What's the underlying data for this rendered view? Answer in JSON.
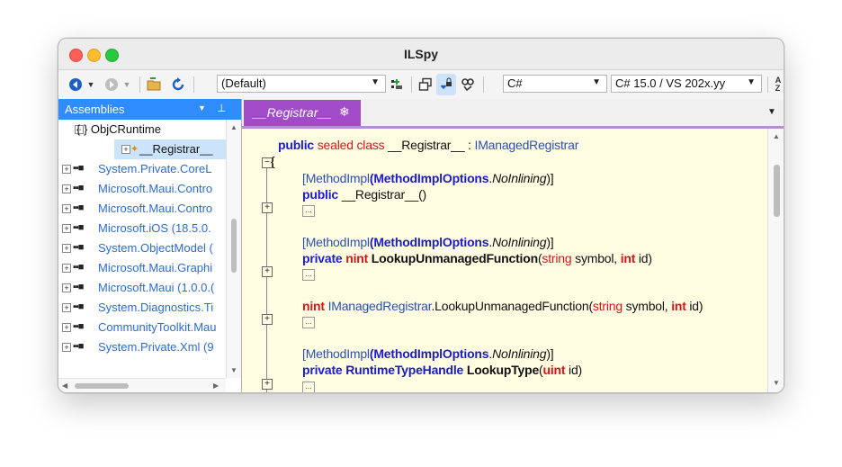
{
  "window": {
    "title": "ILSpy"
  },
  "toolbar": {
    "profile_combo": "(Default)",
    "language_combo": "C#",
    "version_combo": "C# 15.0 / VS 202x.yy"
  },
  "assemblies_panel": {
    "header": "Assemblies",
    "tree": [
      {
        "label": "{ } ObjCRuntime",
        "style": "dark",
        "indent": 1
      },
      {
        "label": "__Registrar__",
        "style": "dark",
        "indent": 2,
        "selected": true
      },
      {
        "label": "System.Private.CoreL",
        "indent": 0
      },
      {
        "label": "Microsoft.Maui.Contro",
        "indent": 0
      },
      {
        "label": "Microsoft.Maui.Contro",
        "indent": 0
      },
      {
        "label": "Microsoft.iOS (18.5.0.",
        "indent": 0
      },
      {
        "label": "System.ObjectModel (",
        "indent": 0
      },
      {
        "label": "Microsoft.Maui.Graphi",
        "indent": 0
      },
      {
        "label": "Microsoft.Maui (1.0.0.(",
        "indent": 0
      },
      {
        "label": "System.Diagnostics.Ti",
        "indent": 0
      },
      {
        "label": "CommunityToolkit.Mau",
        "indent": 0
      },
      {
        "label": "System.Private.Xml (9",
        "indent": 0
      }
    ]
  },
  "editor": {
    "tab_label": "__Registrar__",
    "code": {
      "l1_kw": "public",
      "l1_mod": "sealed class",
      "l1_name": "__Registrar__",
      "l1_rest": " : ",
      "l1_iface": "IManagedRegistrar",
      "brace": "{",
      "attr_open": "[",
      "attr_name": "MethodImpl",
      "attr_paren": "(",
      "attr_enum": "MethodImplOptions",
      "attr_dot": ".",
      "attr_val": "NoInlining",
      "attr_close": ")]",
      "ctor_kw": "public",
      "ctor_name": "__Registrar__()",
      "m2_kw": "private",
      "m2_type": "nint",
      "m2_name": "LookupUnmanagedFunction",
      "m2_p1type": "string",
      "m2_p1": " symbol, ",
      "m2_p2type": "int",
      "m2_p2": " id)",
      "m3_type": "nint",
      "m3_iface": "IManagedRegistrar",
      "m3_name": ".LookupUnmanagedFunction(",
      "m4_kw": "private",
      "m4_type": "RuntimeTypeHandle",
      "m4_name": "LookupType",
      "m4_ptype": "uint",
      "m4_rest": " id)",
      "ellipsis": "..."
    }
  }
}
